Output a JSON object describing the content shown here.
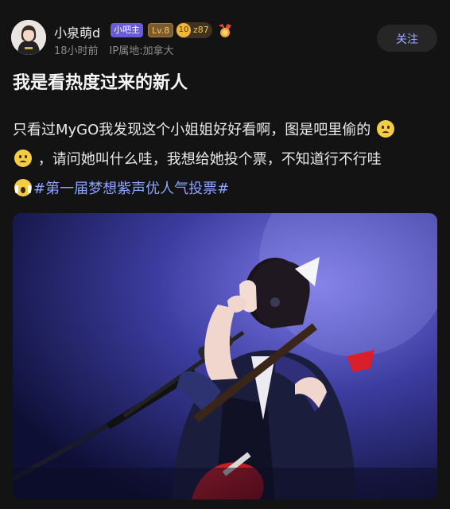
{
  "user": {
    "name": "小泉萌d",
    "badge_owner": "小吧主",
    "badge_level": "Lv.8",
    "fan_level": "10",
    "fan_count": "z87",
    "time_ago": "18小时前",
    "ip_location": "IP属地:加拿大"
  },
  "follow_label": "关注",
  "post": {
    "title": "我是看热度过来的新人",
    "text_1": "只看过MyGO我发现这个小姐姐好好看啊，图是吧里偷的",
    "text_2": "，请问她叫什么哇，我想给她投个票，不知道行不行哇",
    "hashtag": "#第一届梦想紫声优人气投票#"
  },
  "icons": {
    "medal": "medal-icon",
    "emoji_1": "worried-face-emoji",
    "emoji_2": "worried-face-emoji",
    "emoji_3": "screaming-face-emoji"
  },
  "colors": {
    "background": "#131313",
    "accent": "#8da3ff",
    "badge_owner": "#6a5ad8"
  }
}
